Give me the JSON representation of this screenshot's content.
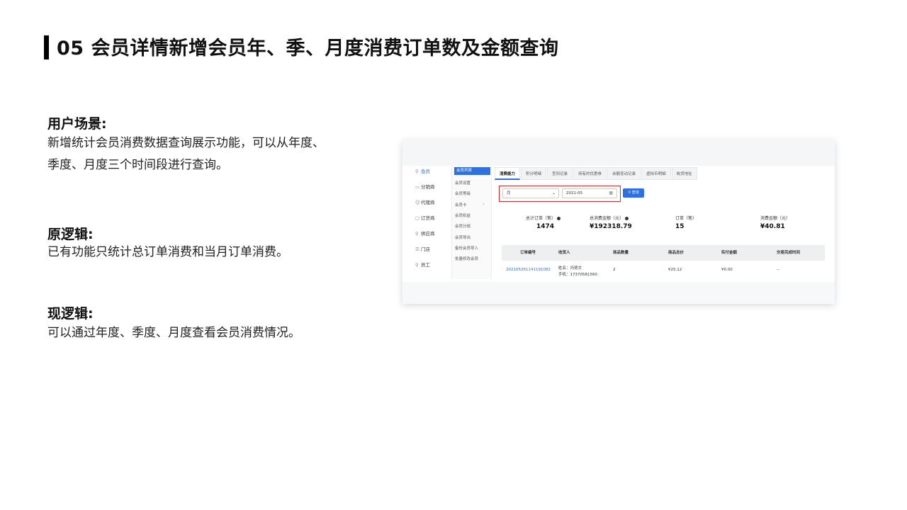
{
  "header": {
    "title": "05 会员详情新增会员年、季、月度消费订单数及金额查询"
  },
  "sections": [
    {
      "heading": "用户场景:",
      "body": "新增统计会员消费数据查询展示功能，可以从年度、季度、月度三个时间段进行查询。"
    },
    {
      "heading": "原逻辑:",
      "body": "已有功能只统计总订单消费和当月订单消费。"
    },
    {
      "heading": "现逻辑:",
      "body": "可以通过年度、季度、月度查看会员消费情况。"
    }
  ],
  "screenshot": {
    "sidebar": [
      {
        "label": "会员",
        "icon": "user-icon",
        "active": true
      },
      {
        "label": "分销商",
        "icon": "list-icon",
        "active": false
      },
      {
        "label": "代理商",
        "icon": "agent-icon",
        "active": false
      },
      {
        "label": "订货商",
        "icon": "box-icon",
        "active": false
      },
      {
        "label": "供应商",
        "icon": "supplier-icon",
        "active": false
      },
      {
        "label": "门店",
        "icon": "store-icon",
        "active": false
      },
      {
        "label": "员工",
        "icon": "staff-icon",
        "active": false
      }
    ],
    "submenu": [
      {
        "label": "会员列表",
        "active": true
      },
      {
        "label": "会员设置",
        "active": false
      },
      {
        "label": "会员等级",
        "active": false
      },
      {
        "label": "会员卡",
        "active": false,
        "has_arrow": true
      },
      {
        "label": "会员权益",
        "active": false
      },
      {
        "label": "会员分组",
        "active": false
      },
      {
        "label": "会员导出",
        "active": false
      },
      {
        "label": "备份会员导入",
        "active": false
      },
      {
        "label": "批量修改会员",
        "active": false
      }
    ],
    "tabs": [
      "消费能力",
      "积分明细",
      "签到记录",
      "持有的优惠券",
      "余额变动记录",
      "虚拟币明细",
      "收货地址"
    ],
    "active_tab": "消费能力",
    "filter": {
      "period": "月",
      "date": "2021-05",
      "query_button": "查询"
    },
    "stats": [
      {
        "label": "总计订单（笔）",
        "value": "1474",
        "info": true
      },
      {
        "label": "总消费金额（元）",
        "value": "¥192318.79",
        "info": true
      },
      {
        "label": "订单（笔）",
        "value": "15",
        "info": false
      },
      {
        "label": "消费金额（元）",
        "value": "¥40.81",
        "info": false
      }
    ],
    "table": {
      "columns": [
        "订单编号",
        "收货人",
        "商品数量",
        "商品总价",
        "实付金额",
        "交易完成时间"
      ],
      "rows": [
        {
          "order_no": "2021052611411910​82",
          "receiver_name": "姓名：冯贤文",
          "receiver_phone": "手机：17370581560",
          "qty": "2",
          "total": "¥25.12",
          "paid": "¥0.00",
          "time": "--"
        }
      ]
    },
    "colors": {
      "accent": "#2f6fde",
      "highlight": "#d42b2b"
    }
  }
}
